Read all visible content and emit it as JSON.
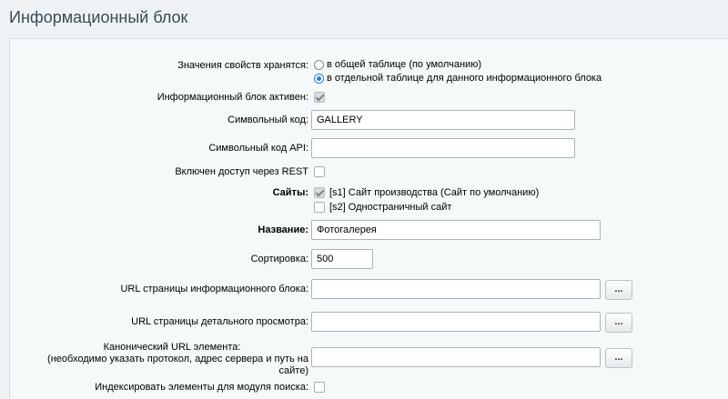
{
  "page_title": "Информационный блок",
  "storage": {
    "label": "Значения свойств хранятся:",
    "options": [
      {
        "text": "в общей таблице (по умолчанию)",
        "checked": false
      },
      {
        "text": "в отдельной таблице для данного информационного блока",
        "checked": true
      }
    ]
  },
  "active": {
    "label": "Информационный блок активен:",
    "checked": true
  },
  "code": {
    "label": "Символьный код:",
    "value": "GALLERY"
  },
  "api_code": {
    "label": "Символьный код API:",
    "value": ""
  },
  "rest": {
    "label": "Включен доступ через REST",
    "checked": false
  },
  "sites": {
    "label": "Сайты:",
    "items": [
      {
        "text": "[s1] Сайт производства (Сайт по умолчанию)",
        "checked": true
      },
      {
        "text": "[s2] Одностраничный сайт",
        "checked": false
      }
    ]
  },
  "name": {
    "label": "Название:",
    "value": "Фотогалерея"
  },
  "sort": {
    "label": "Сортировка:",
    "value": "500"
  },
  "list_url": {
    "label": "URL страницы информационного блока:",
    "value": "",
    "button": "..."
  },
  "detail_url": {
    "label": "URL страницы детального просмотра:",
    "value": "",
    "button": "..."
  },
  "canonical_url": {
    "label": "Канонический URL элемента:",
    "hint": "(необходимо указать протокол, адрес сервера и путь на сайте)",
    "value": "",
    "button": "..."
  },
  "index": {
    "label": "Индексировать элементы для модуля поиска:",
    "checked": false
  }
}
